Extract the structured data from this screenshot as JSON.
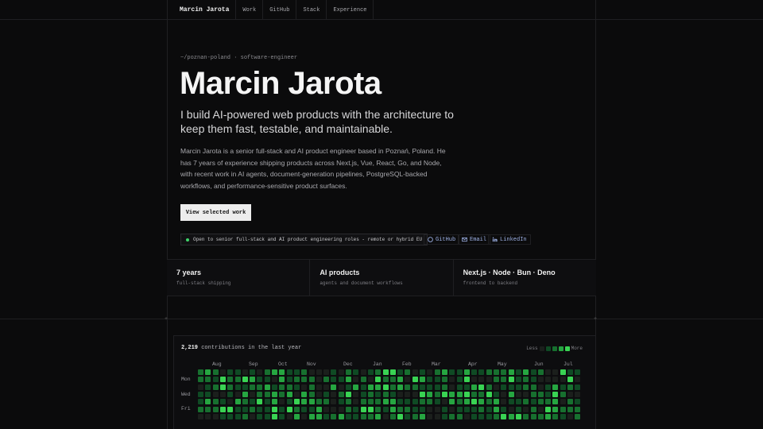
{
  "nav": {
    "brand": "Marcin Jarota",
    "links": [
      "Work",
      "GitHub",
      "Stack",
      "Experience"
    ]
  },
  "hero": {
    "eyebrow": "~/poznan-poland · software-engineer",
    "title": "Marcin Jarota",
    "tagline": "I build AI-powered web products with the architecture to keep them fast, testable, and maintainable.",
    "bio": "Marcin Jarota is a senior full-stack and AI product engineer based in Poznań, Poland. He has 7 years of experience shipping products across Next.js, Vue, React, Go, and Node, with recent work in AI agents, document-generation pipelines, PostgreSQL-backed workflows, and performance-sensitive product surfaces.",
    "cta": "View selected work",
    "status": "Open to senior full-stack and AI product engineering roles - remote or hybrid EU",
    "socials": {
      "github": "GitHub",
      "email": "Email",
      "linkedin": "LinkedIn"
    }
  },
  "stats": [
    {
      "value": "7 years",
      "desc": "full-stack shipping"
    },
    {
      "value": "AI products",
      "desc": "agents and document workflows"
    },
    {
      "value": "Next.js · Node · Bun · Deno",
      "desc": "frontend to backend"
    }
  ],
  "contributions": {
    "count": "2,219",
    "label": "contributions in the last year",
    "legend_less": "Less",
    "legend_more": "More",
    "months": [
      "Aug",
      "Sep",
      "Oct",
      "Nov",
      "Dec",
      "Jan",
      "Feb",
      "Mar",
      "Apr",
      "May",
      "Jun",
      "Jul"
    ],
    "days": [
      "Mon",
      "Wed",
      "Fri"
    ],
    "colors": [
      "#1b1f1c",
      "#0f4a24",
      "#17702f",
      "#26a641",
      "#39d353"
    ]
  }
}
